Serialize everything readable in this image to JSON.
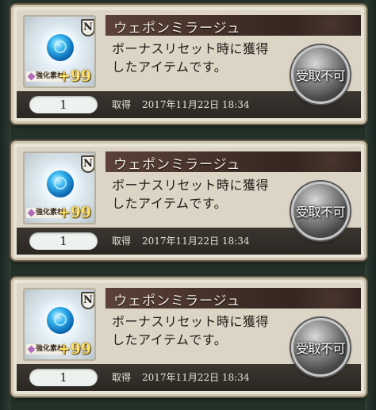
{
  "items": [
    {
      "name": "ウェポンミラージュ",
      "rarity": "N",
      "material_label": "強化素材",
      "count": "+99",
      "description_line1": "ボーナスリセット時に獲得",
      "description_line2": "したアイテムです。",
      "quantity": "1",
      "acquired_label": "取得",
      "acquired_date": "2017年11月22日 18:34",
      "action_label": "受取不可"
    },
    {
      "name": "ウェポンミラージュ",
      "rarity": "N",
      "material_label": "強化素材",
      "count": "+99",
      "description_line1": "ボーナスリセット時に獲得",
      "description_line2": "したアイテムです。",
      "quantity": "1",
      "acquired_label": "取得",
      "acquired_date": "2017年11月22日 18:34",
      "action_label": "受取不可"
    },
    {
      "name": "ウェポンミラージュ",
      "rarity": "N",
      "material_label": "強化素材",
      "count": "+99",
      "description_line1": "ボーナスリセット時に獲得",
      "description_line2": "したアイテムです。",
      "quantity": "1",
      "acquired_label": "取得",
      "acquired_date": "2017年11月22日 18:34",
      "action_label": "受取不可"
    }
  ],
  "colors": {
    "background": "#243129",
    "card": "#dcd4c5",
    "title_bar": "#3b2a24",
    "count_text": "#ffe06a"
  },
  "icons": {
    "item": "blue-orb-icon",
    "rarity": "rarity-n-icon",
    "material": "diamond-icon"
  }
}
